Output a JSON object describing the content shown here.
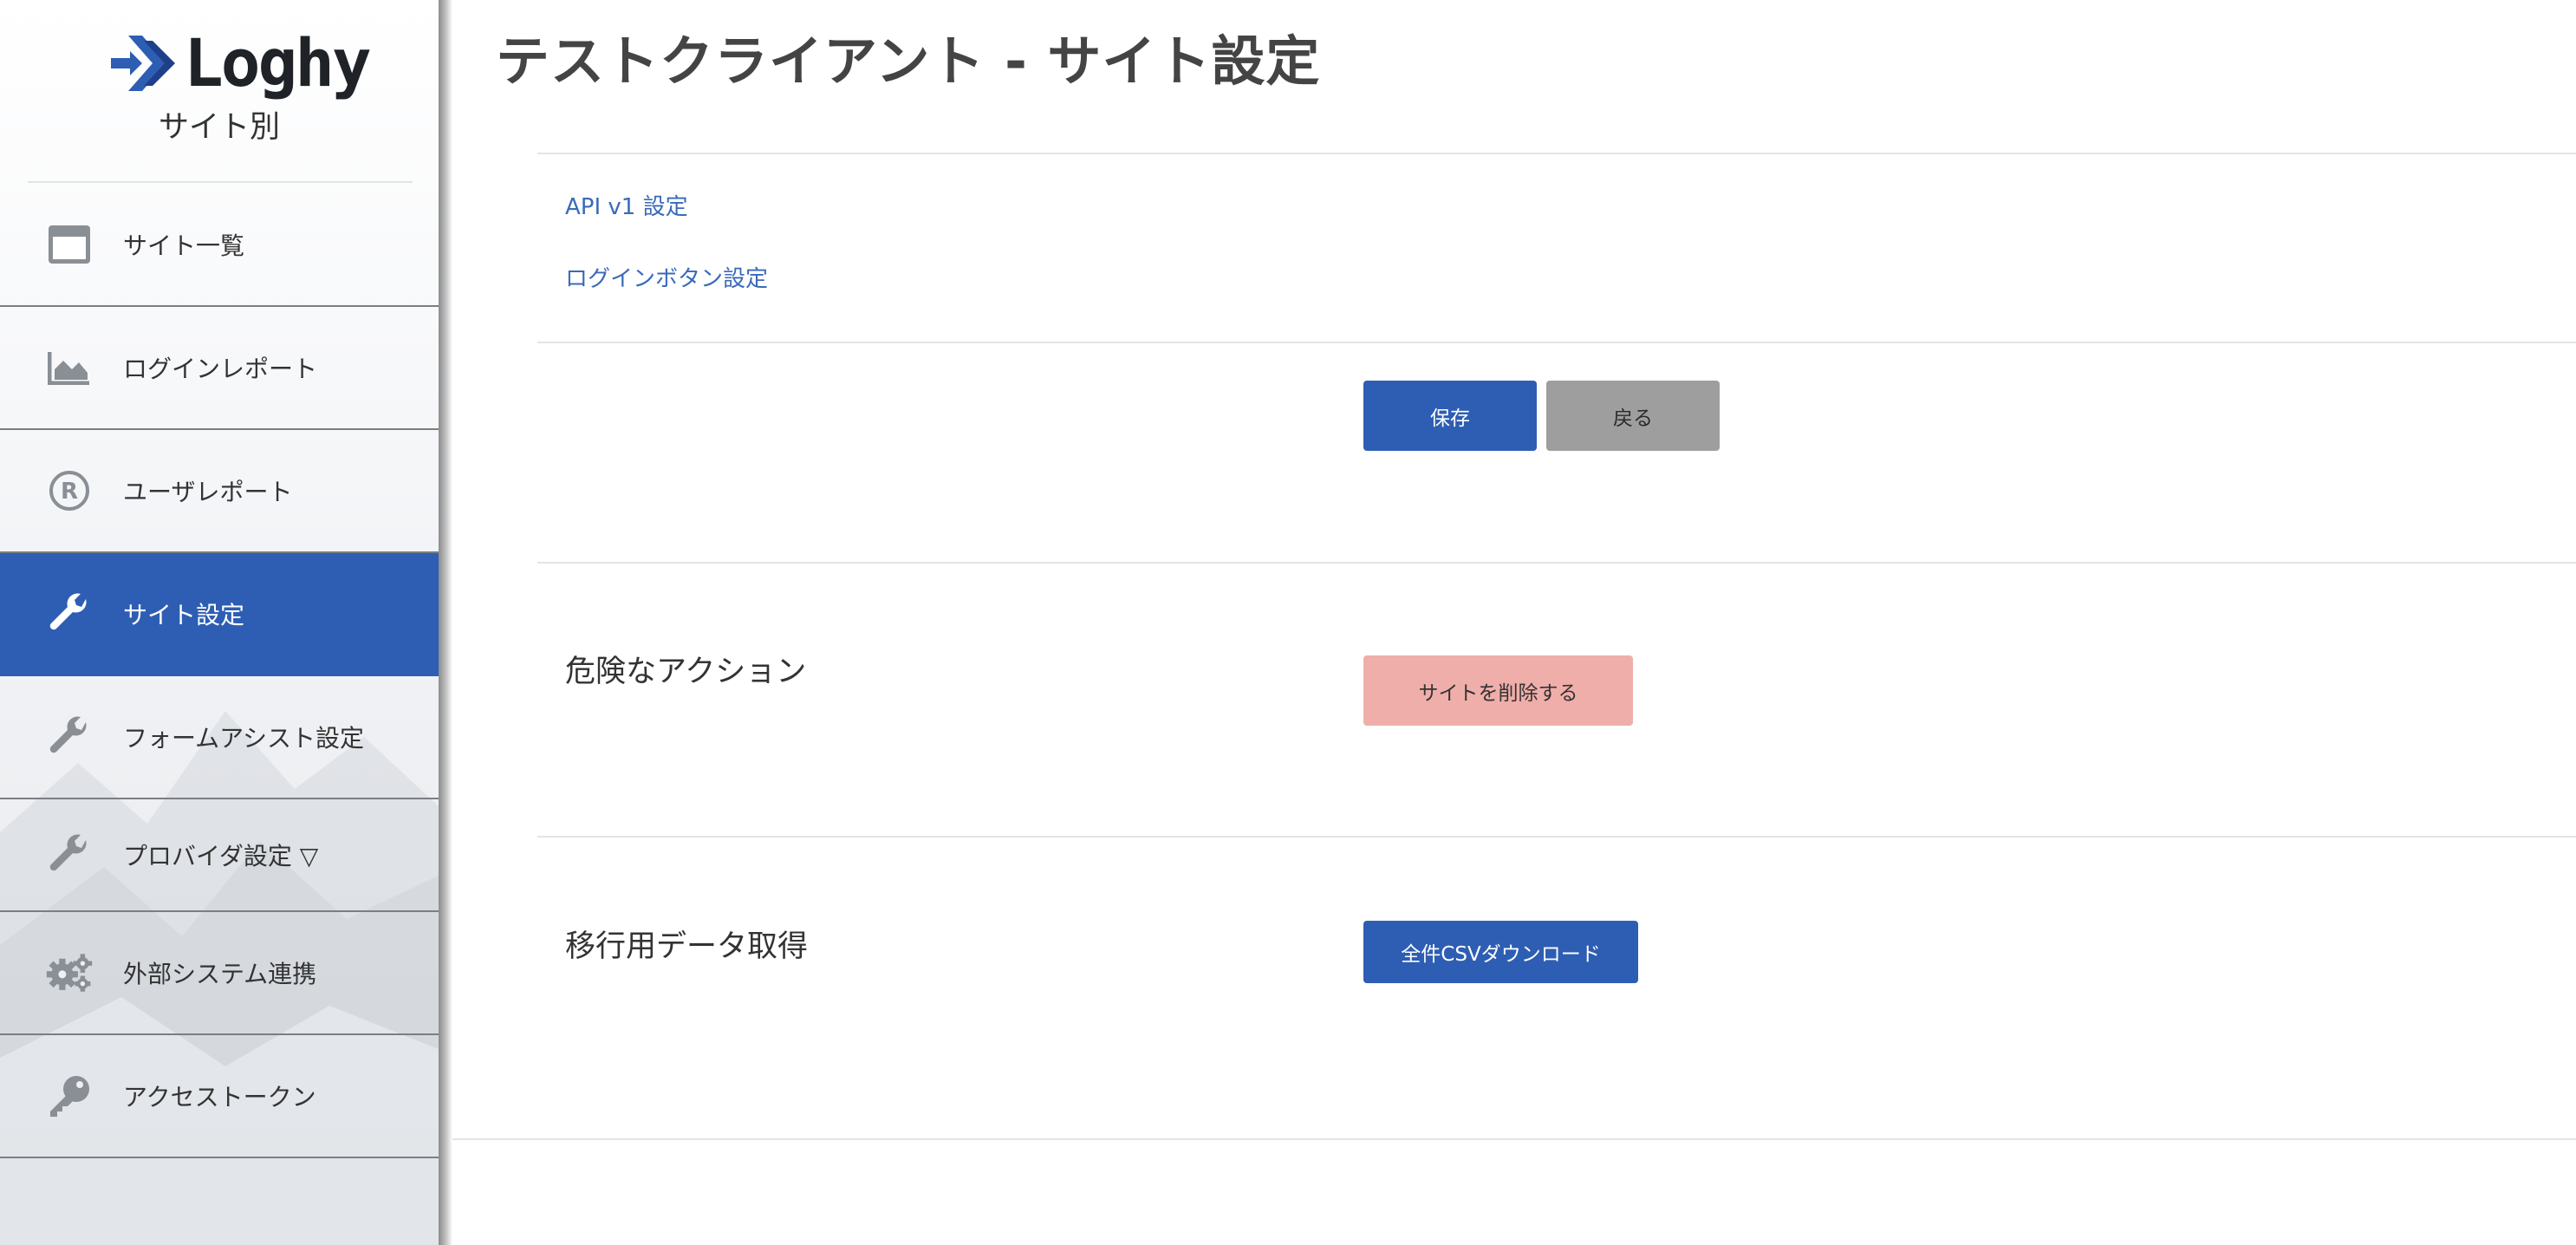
{
  "sidebar": {
    "logo_text": "Loghy",
    "subtitle": "サイト別",
    "items": [
      {
        "label": "サイト一覧",
        "icon": "window-icon",
        "active": false
      },
      {
        "label": "ログインレポート",
        "icon": "area-chart-icon",
        "active": false
      },
      {
        "label": "ユーザレポート",
        "icon": "registered-icon",
        "active": false
      },
      {
        "label": "サイト設定",
        "icon": "wrench-icon",
        "active": true
      },
      {
        "label": "フォームアシスト設定",
        "icon": "wrench-icon",
        "active": false
      },
      {
        "label": "プロバイダ設定 ▽",
        "icon": "wrench-icon",
        "active": false
      },
      {
        "label": "外部システム連携",
        "icon": "gears-icon",
        "active": false
      },
      {
        "label": "アクセストークン",
        "icon": "key-icon",
        "active": false
      }
    ]
  },
  "main": {
    "title": "テストクライアント - サイト設定",
    "links": [
      "API v1 設定",
      "ログインボタン設定"
    ],
    "save_label": "保存",
    "back_label": "戻る",
    "danger_heading": "危険なアクション",
    "delete_label": "サイトを削除する",
    "migration_heading": "移行用データ取得",
    "csv_label": "全件CSVダウンロード"
  },
  "colors": {
    "accent": "#2e5eb3",
    "link": "#3a6ab8",
    "danger": "#f0aeaa",
    "neutral": "#9e9e9e"
  }
}
